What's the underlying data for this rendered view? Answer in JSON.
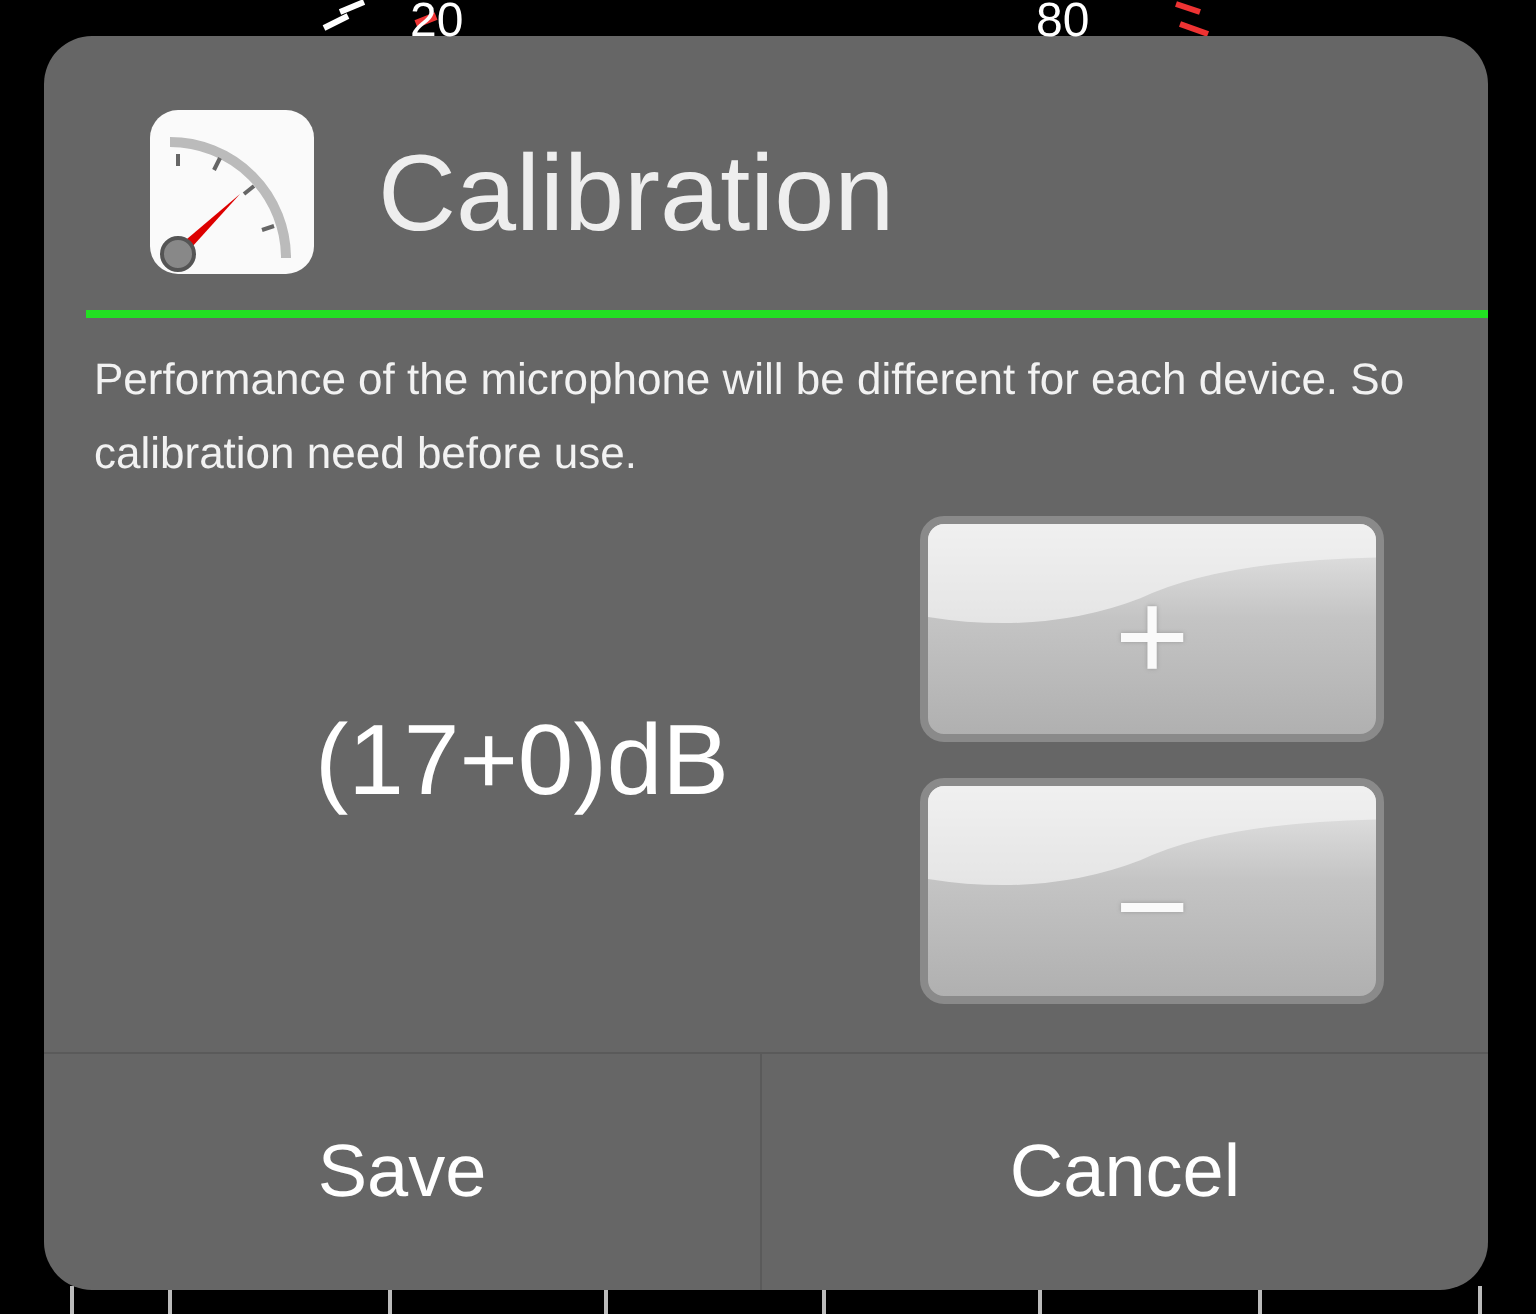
{
  "background": {
    "gauge_labels": [
      "20",
      "80"
    ]
  },
  "dialog": {
    "title": "Calibration",
    "description": "Performance of the microphone will be different for each device. So calibration need before use.",
    "value": "(17+0)dB",
    "steppers": [
      {
        "kind": "increment",
        "label": "+"
      },
      {
        "kind": "decrement",
        "label": "−"
      }
    ],
    "actions": [
      "Save",
      "Cancel"
    ]
  }
}
